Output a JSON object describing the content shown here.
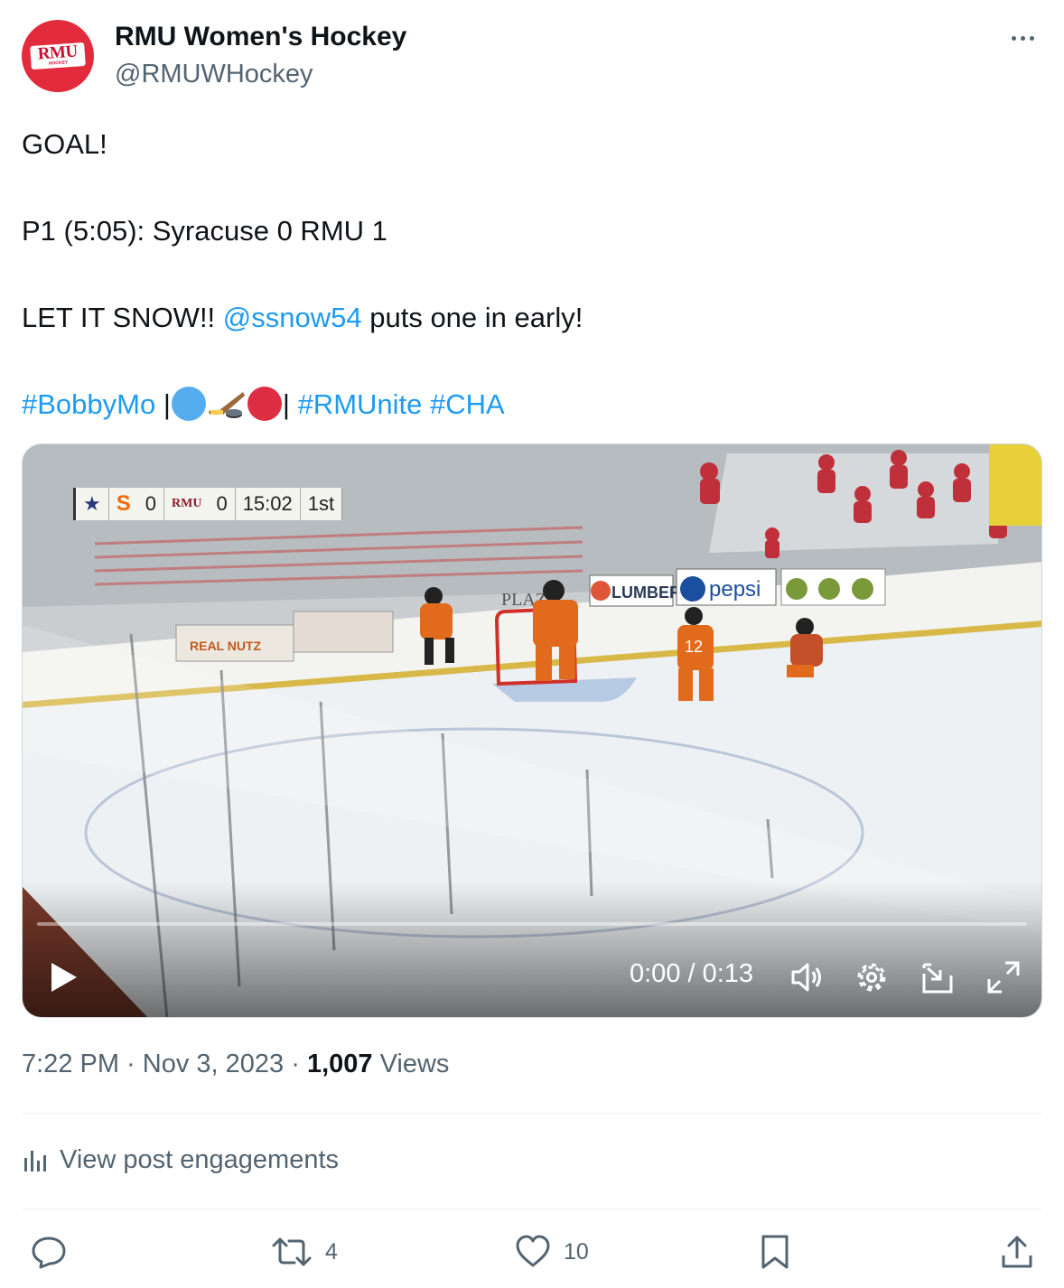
{
  "author": {
    "name": "RMU Women's Hockey",
    "handle": "@RMUWHockey",
    "avatar_text": "RMU",
    "avatar_subtext": "HOCKEY",
    "avatar_color": "#e22b3c"
  },
  "tweet": {
    "line1": "GOAL!",
    "line2": "P1 (5:05): Syracuse 0 RMU 1",
    "line3_before": "LET IT SNOW!! ",
    "line3_mention": "@ssnow54",
    "line3_after": " puts one in early!",
    "hashtag1": "#BobbyMo",
    "separator_left": " |",
    "separator_right": "| ",
    "hashtag2": "#RMUnite",
    "hashtag3": "#CHA",
    "emojis": [
      "blue-circle",
      "ice-hockey",
      "red-circle"
    ]
  },
  "video": {
    "scorebug": {
      "team1": "S",
      "score1": "0",
      "team2": "RMU",
      "score2": "0",
      "clock": "15:02",
      "period": "1st"
    },
    "rink_ads": [
      "LUMBER",
      "pepsi",
      "PLAZA",
      "REAL NUTZ"
    ],
    "jersey_number": "12",
    "time_display": "0:00 / 0:13",
    "progress": 0
  },
  "meta": {
    "time": "7:22 PM",
    "date": "Nov 3, 2023",
    "separator": " · ",
    "views_count": "1,007",
    "views_label": " Views"
  },
  "engagements": {
    "label": "View post engagements"
  },
  "actions": {
    "reply_count": "",
    "repost_count": "4",
    "like_count": "10"
  },
  "colors": {
    "link": "#1d9bf0",
    "text": "#0f1419",
    "secondary": "#536471"
  }
}
